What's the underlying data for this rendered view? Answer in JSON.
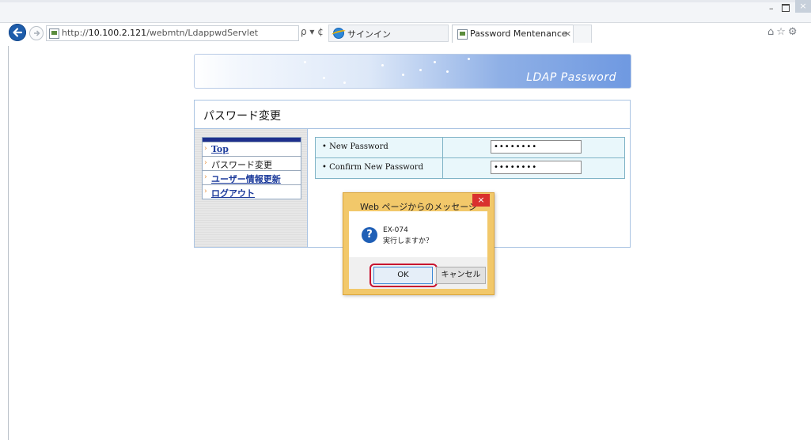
{
  "browser": {
    "address_prefix": "http://",
    "address_host": "10.100.2.121",
    "address_path": "/webmtn/LdappwdServlet",
    "address_tools": "ρ ▾ ¢",
    "tab_signin_label": "サインイン",
    "tab_active_label": "Password Mentenance",
    "tab_close": "×",
    "window_min": "–",
    "window_close": "×",
    "toolbar_icons": "⌂☆⚙"
  },
  "banner": {
    "title": "LDAP Password"
  },
  "page": {
    "heading": "パスワード変更"
  },
  "menu": {
    "arrow": "›",
    "items": [
      {
        "label": "Top",
        "link": true
      },
      {
        "label": "パスワード変更",
        "link": false
      },
      {
        "label": "ユーザー情報更新",
        "link": true
      },
      {
        "label": "ログアウト",
        "link": true
      }
    ]
  },
  "form": {
    "rows": [
      {
        "label": "• New Password",
        "value": "••••••••"
      },
      {
        "label": "• Confirm New Password",
        "value": "••••••••"
      }
    ]
  },
  "dialog": {
    "title": "Web ページからのメッセージ",
    "close_glyph": "×",
    "icon_glyph": "?",
    "code": "EX-074",
    "message": "実行しますか？",
    "ok_label": "OK",
    "cancel_label": "キャンセル",
    "highlight_color": "#c8102e"
  }
}
